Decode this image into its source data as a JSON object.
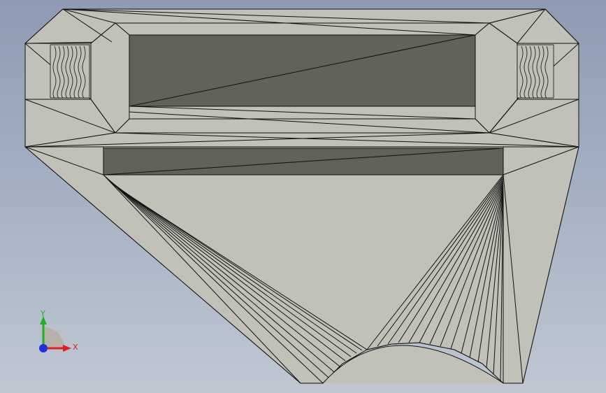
{
  "viewport": {
    "title": "",
    "colors": {
      "background_top": "#8e9bb3",
      "background_bottom": "#c0c7d3",
      "face": "#c1c1b8",
      "recess": "#62625a",
      "edge": "#111111"
    }
  },
  "triad": {
    "x_label": "X",
    "y_label": "Y",
    "x_color": "#e02020",
    "y_color": "#20b020",
    "z_color": "#2030e0",
    "icon": "coordinate-triad-icon"
  }
}
